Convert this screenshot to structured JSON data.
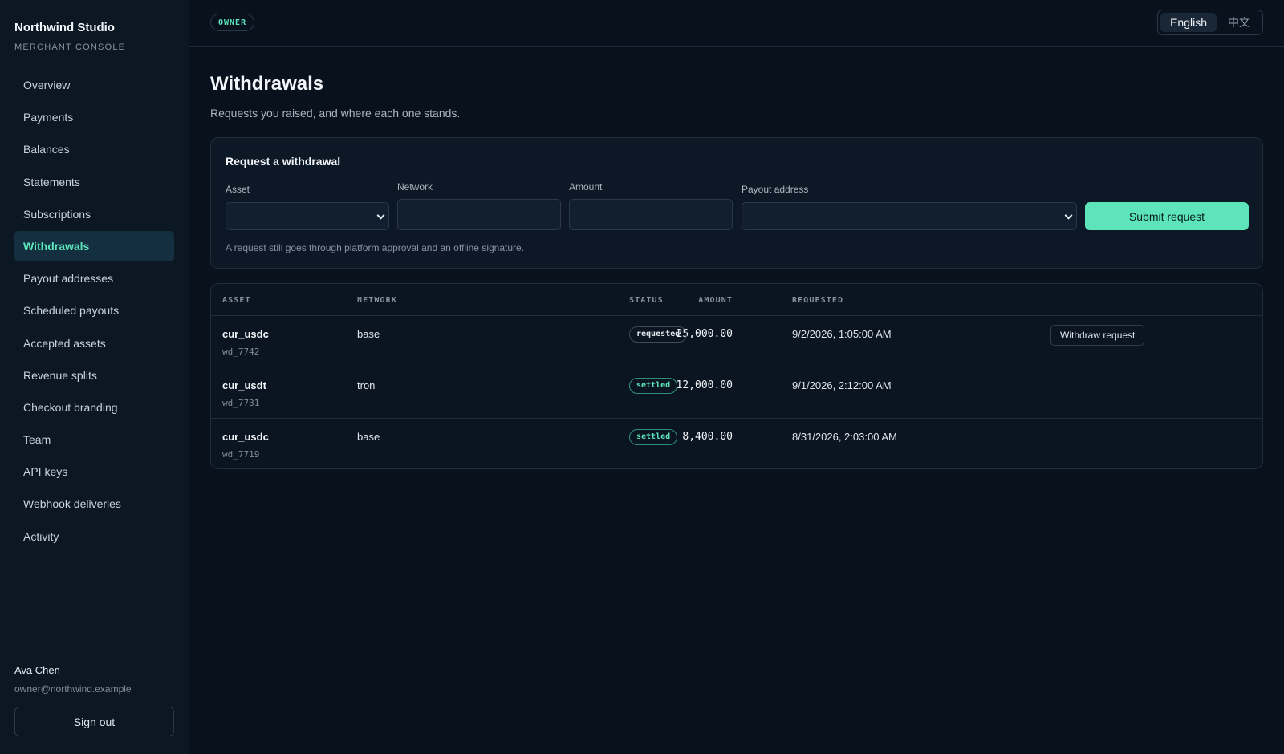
{
  "brand": {
    "name": "Northwind Studio",
    "subtitle": "MERCHANT CONSOLE"
  },
  "nav": [
    {
      "label": "Overview"
    },
    {
      "label": "Payments"
    },
    {
      "label": "Balances"
    },
    {
      "label": "Statements"
    },
    {
      "label": "Subscriptions"
    },
    {
      "label": "Withdrawals",
      "active": true
    },
    {
      "label": "Payout addresses"
    },
    {
      "label": "Scheduled payouts"
    },
    {
      "label": "Accepted assets"
    },
    {
      "label": "Revenue splits"
    },
    {
      "label": "Checkout branding"
    },
    {
      "label": "Team"
    },
    {
      "label": "API keys"
    },
    {
      "label": "Webhook deliveries"
    },
    {
      "label": "Activity"
    }
  ],
  "user": {
    "name": "Ava Chen",
    "email": "owner@northwind.example",
    "signout_label": "Sign out"
  },
  "topbar": {
    "role": "OWNER",
    "lang_en": "English",
    "lang_zh": "中文",
    "active_lang": "English"
  },
  "page": {
    "title": "Withdrawals",
    "subtitle": "Requests you raised, and where each one stands."
  },
  "form": {
    "title": "Request a withdrawal",
    "asset_label": "Asset",
    "asset_value": "",
    "network_label": "Network",
    "network_value": "",
    "amount_label": "Amount",
    "amount_value": "",
    "address_label": "Payout address",
    "address_value": "",
    "submit_label": "Submit request",
    "note": "A request still goes through platform approval and an offline signature."
  },
  "table": {
    "headers": {
      "asset": "ASSET",
      "network": "NETWORK",
      "amount": "AMOUNT",
      "status": "STATUS",
      "requested": "REQUESTED"
    },
    "withdraw_label": "Withdraw request",
    "rows": [
      {
        "asset": "cur_usdc",
        "id": "wd_7742",
        "network": "base",
        "amount": "25,000.00",
        "status": "requested",
        "requested_at": "9/2/2026, 1:05:00 AM"
      },
      {
        "asset": "cur_usdt",
        "id": "wd_7731",
        "network": "tron",
        "amount": "12,000.00",
        "status": "settled",
        "requested_at": "9/1/2026, 2:12:00 AM"
      },
      {
        "asset": "cur_usdc",
        "id": "wd_7719",
        "network": "base",
        "amount": "8,400.00",
        "status": "settled",
        "requested_at": "8/31/2026, 2:03:00 AM"
      }
    ]
  },
  "colors": {
    "accent": "#5de4bb",
    "background": "#08111c",
    "sidebar": "#0c1724",
    "active_nav": "#143040"
  }
}
